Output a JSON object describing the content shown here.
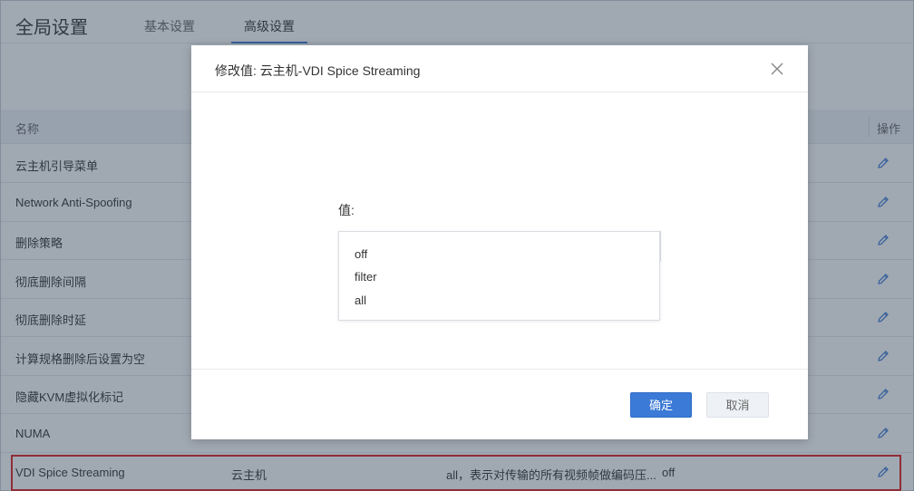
{
  "header": {
    "title": "全局设置",
    "tabs": [
      {
        "label": "基本设置",
        "active": false
      },
      {
        "label": "高级设置",
        "active": true
      }
    ]
  },
  "table": {
    "columns": {
      "name": "名称",
      "op": "操作"
    },
    "rows": [
      {
        "name": "云主机引导菜单"
      },
      {
        "name": "Network Anti-Spoofing"
      },
      {
        "name": "删除策略"
      },
      {
        "name": "彻底删除间隔"
      },
      {
        "name": "彻底删除时延"
      },
      {
        "name": "计算规格删除后设置为空"
      },
      {
        "name": "隐藏KVM虚拟化标记"
      },
      {
        "name": "NUMA"
      },
      {
        "name": "VDI Spice Streaming",
        "type": "云主机",
        "desc": "all，表示对传输的所有视频帧做编码压...",
        "value": "off"
      }
    ]
  },
  "modal": {
    "title": "修改值: 云主机-VDI Spice Streaming",
    "field_label": "值:",
    "options": [
      "off",
      "filter",
      "all"
    ],
    "confirm_label": "确定",
    "cancel_label": "取消"
  },
  "colors": {
    "accent": "#3b7ad6",
    "highlight": "#e02020"
  },
  "icons": {
    "edit": "pencil-icon",
    "close": "close-icon"
  }
}
